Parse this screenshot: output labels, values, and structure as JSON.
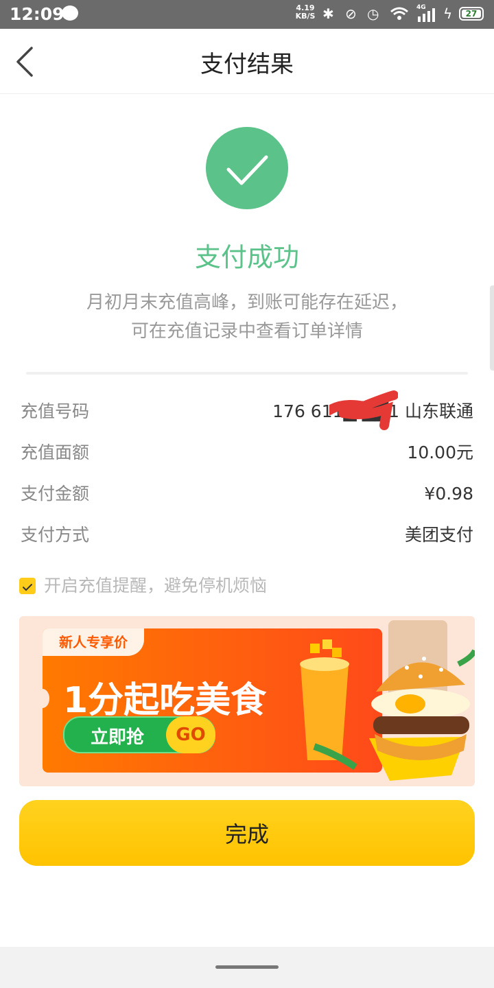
{
  "status_bar": {
    "time": "12:09",
    "net_speed_value": "4.19",
    "net_speed_unit": "KB/S",
    "network_type": "4G",
    "battery": "27"
  },
  "header": {
    "title": "支付结果"
  },
  "result": {
    "title": "支付成功",
    "notice_line1": "月初月末充值高峰，到账可能存在延迟，",
    "notice_line2": "可在充值记录中查看订单详情"
  },
  "details": [
    {
      "label": "充值号码",
      "value": "176 611█ ██1 山东联通"
    },
    {
      "label": "充值面额",
      "value": "10.00元"
    },
    {
      "label": "支付金额",
      "value": "¥0.98"
    },
    {
      "label": "支付方式",
      "value": "美团支付"
    }
  ],
  "reminder": {
    "text": "开启充值提醒，避免停机烦恼",
    "checked": true
  },
  "banner": {
    "tag": "新人专享价",
    "headline": "1分起吃美食",
    "button": "立即抢",
    "go": "GO"
  },
  "done_button": "完成",
  "colors": {
    "success_green": "#5bc28a",
    "accent_yellow": "#ffc300",
    "status_bar": "#6b6b6b"
  }
}
